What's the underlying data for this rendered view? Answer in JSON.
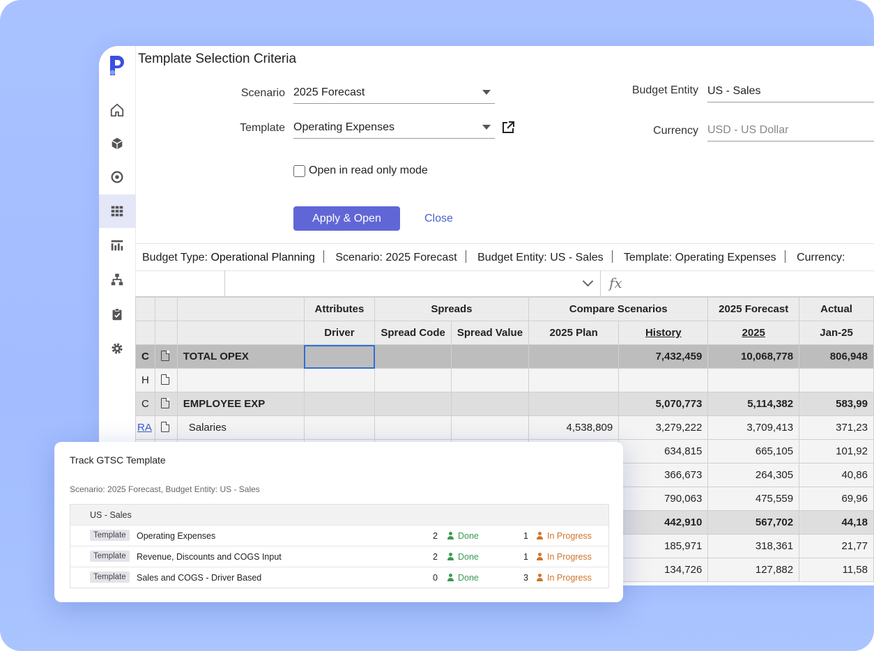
{
  "header": {
    "title": "Template Selection Criteria"
  },
  "form": {
    "scenario_label": "Scenario",
    "scenario_value": "2025 Forecast",
    "template_label": "Template",
    "template_value": "Operating Expenses",
    "entity_label": "Budget Entity",
    "entity_value": "US - Sales",
    "currency_label": "Currency",
    "currency_value": "USD - US Dollar",
    "readonly_label": "Open in read only mode",
    "apply_label": "Apply & Open",
    "close_label": "Close"
  },
  "info_bar": [
    {
      "key": "Budget Type: ",
      "value": "Operational Planning"
    },
    {
      "key": "Scenario: ",
      "value": "2025 Forecast"
    },
    {
      "key": "Budget Entity: ",
      "value": "US - Sales"
    },
    {
      "key": "Template: ",
      "value": "Operating Expenses"
    },
    {
      "key": "Currency: ",
      "value": ""
    }
  ],
  "grid": {
    "group_headers": {
      "attributes": "Attributes",
      "spreads": "Spreads",
      "compare": "Compare Scenarios",
      "forecast": "2025 Forecast",
      "actual": "Actual"
    },
    "col_headers": {
      "driver": "Driver",
      "spread_code": "Spread Code",
      "spread_value": "Spread Value",
      "plan": "2025 Plan",
      "history": "History",
      "year": "2025",
      "month": "Jan-25"
    },
    "rows": [
      {
        "type": "C",
        "label": "TOTAL OPEX",
        "plan": "",
        "history": "7,432,459",
        "forecast": "10,068,778",
        "actual": "806,948"
      },
      {
        "type": "H",
        "label": "",
        "plan": "",
        "history": "",
        "forecast": "",
        "actual": ""
      },
      {
        "type": "C",
        "label": "EMPLOYEE EXP",
        "plan": "",
        "history": "5,070,773",
        "forecast": "5,114,382",
        "actual": "583,99"
      },
      {
        "type": "RA",
        "label": "Salaries",
        "plan": "4,538,809",
        "history": "3,279,222",
        "forecast": "3,709,413",
        "actual": "371,23"
      },
      {
        "history": "634,815",
        "forecast": "665,105",
        "actual": "101,92"
      },
      {
        "history": "366,673",
        "forecast": "264,305",
        "actual": "40,86"
      },
      {
        "history": "790,063",
        "forecast": "475,559",
        "actual": "69,96"
      },
      {
        "history": "442,910",
        "forecast": "567,702",
        "actual": "44,18"
      },
      {
        "history": "185,971",
        "forecast": "318,361",
        "actual": "21,77"
      },
      {
        "history": "134,726",
        "forecast": "127,882",
        "actual": "11,58"
      }
    ]
  },
  "popup": {
    "title": "Track GTSC Template",
    "subtitle": "Scenario: 2025 Forecast, Budget Entity: US - Sales",
    "entity": "US - Sales",
    "tag_label": "Template",
    "done_label": "Done",
    "progress_label": "In Progress",
    "items": [
      {
        "name": "Operating Expenses",
        "done": "2",
        "in_progress": "1"
      },
      {
        "name": "Revenue, Discounts and COGS Input",
        "done": "2",
        "in_progress": "1"
      },
      {
        "name": "Sales and COGS - Driver Based",
        "done": "0",
        "in_progress": "3"
      }
    ]
  },
  "colors": {
    "accent": "#6166d6",
    "done": "#3b9a4f",
    "progress": "#d0742a",
    "logo": "#3b4fe0"
  },
  "sidebar": {
    "icons": [
      "home-icon",
      "cube-icon",
      "target-icon",
      "grid-icon",
      "chart-icon",
      "hierarchy-icon",
      "clipboard-icon",
      "gear-icon"
    ]
  }
}
